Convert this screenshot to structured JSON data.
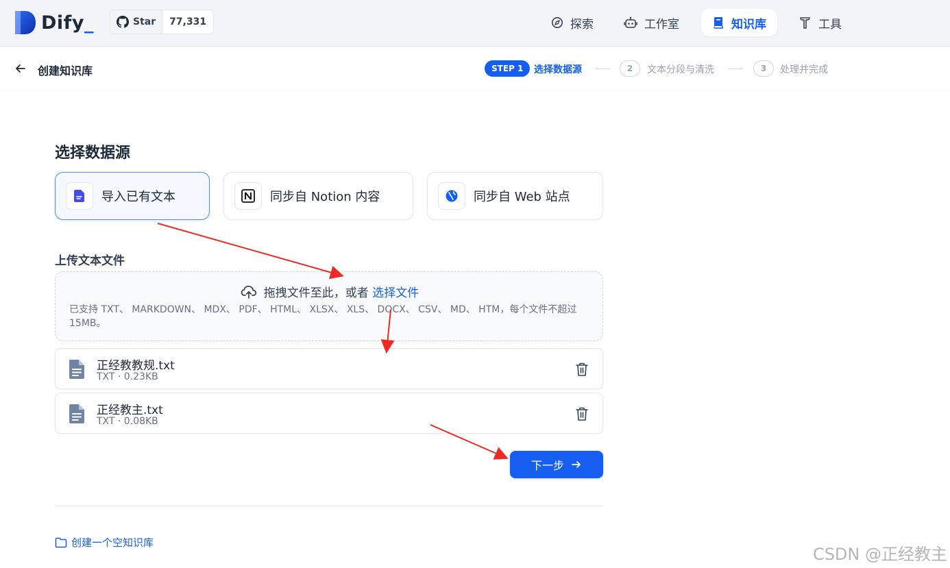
{
  "brand": {
    "name": "Dify",
    "underscore": "_"
  },
  "github": {
    "star_label": "Star",
    "count": "77,331"
  },
  "nav": {
    "explore": "探索",
    "studio": "工作室",
    "knowledge": "知识库",
    "tools": "工具"
  },
  "header": {
    "title": "创建知识库",
    "steps": {
      "step1_badge": "STEP 1",
      "step1_label": "选择数据源",
      "step2_num": "2",
      "step2_label": "文本分段与清洗",
      "step3_num": "3",
      "step3_label": "处理并完成"
    }
  },
  "main": {
    "section_title": "选择数据源",
    "sources": [
      {
        "label": "导入已有文本",
        "icon": "document-icon"
      },
      {
        "label": "同步自 Notion 内容",
        "icon": "notion-icon"
      },
      {
        "label": "同步自 Web 站点",
        "icon": "globe-icon"
      }
    ],
    "upload_title": "上传文本文件",
    "dropzone": {
      "text": "拖拽文件至此，或者",
      "link": "选择文件",
      "hint": "已支持 TXT、 MARKDOWN、 MDX、 PDF、 HTML、 XLSX、 XLS、 DOCX、 CSV、 MD、 HTM，每个文件不超过 15MB。"
    },
    "files": [
      {
        "name": "正经教教规.txt",
        "meta": "TXT · 0.23KB"
      },
      {
        "name": "正经教主.txt",
        "meta": "TXT · 0.08KB"
      }
    ],
    "next_button": "下一步",
    "create_empty": "创建一个空知识库"
  },
  "watermark": "CSDN @正经教主",
  "colors": {
    "accent": "#155eef",
    "annotation_arrow": "#ee2a24"
  }
}
